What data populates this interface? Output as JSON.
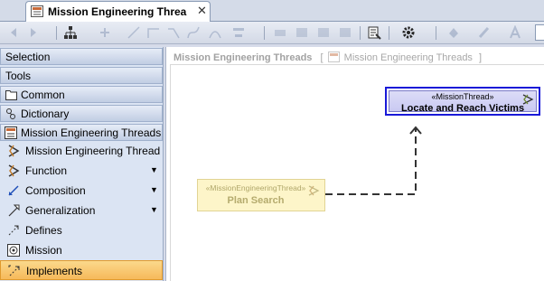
{
  "tab": {
    "title": "Mission Engineering Threa",
    "close_glyph": "✕"
  },
  "toolbar": {
    "icons": [
      "back-arrow-icon",
      "forward-arrow-icon",
      "layout-tree-icon",
      "add-element-icon",
      "path-straight-icon",
      "path-rect-icon",
      "path-oblique-icon",
      "path-spline-icon",
      "path-curve-icon",
      "align-icon",
      "layout-grid-icon",
      "box-icon",
      "box-icon-2",
      "box-icon-3",
      "properties-icon",
      "gear-icon",
      "fill-color-icon",
      "line-color-icon",
      "font-color-icon"
    ]
  },
  "palette": {
    "headers": [
      "Selection",
      "Tools",
      "Common",
      "Dictionary",
      "Mission Engineering Threads"
    ],
    "items": [
      {
        "label": "Mission Engineering Thread",
        "icon": "mission-engineering-thread-icon",
        "dropdown": false
      },
      {
        "label": "Function",
        "icon": "function-icon",
        "dropdown": true
      },
      {
        "label": "Composition",
        "icon": "composition-icon",
        "dropdown": true
      },
      {
        "label": "Generalization",
        "icon": "generalization-icon",
        "dropdown": true
      },
      {
        "label": "Defines",
        "icon": "defines-icon",
        "dropdown": false
      },
      {
        "label": "Mission",
        "icon": "mission-icon",
        "dropdown": false
      },
      {
        "label": "Implements",
        "icon": "implements-icon",
        "dropdown": false,
        "selected": true
      }
    ],
    "dropdown_glyph": "▼"
  },
  "canvas": {
    "frame_title": "Mission Engineering Threads",
    "frame_bracket_open": "[",
    "frame_bracket_close": "]",
    "frame_subtitle": "Mission Engineering Threads",
    "mission_thread": {
      "stereotype": "«MissionThread»",
      "name": "Locate and Reach Victims"
    },
    "engineering_thread": {
      "stereotype": "«MissionEngineeringThread»",
      "name": "Plan Search"
    }
  },
  "colors": {
    "selection_border": "#1919d8",
    "selected_item": "#f6b95a",
    "palette_bg": "#dbe4f3"
  }
}
